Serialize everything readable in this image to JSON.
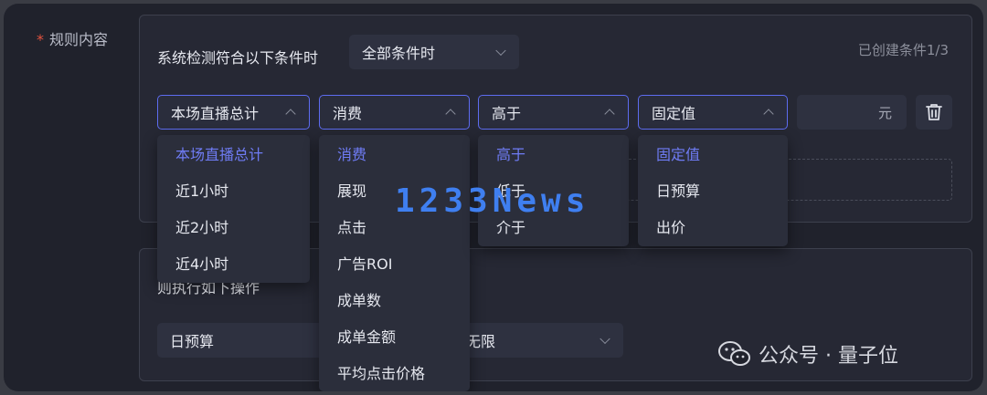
{
  "rule_label": "规则内容",
  "required_mark": "*",
  "trigger": {
    "label": "系统检测符合以下条件时",
    "select_value": "全部条件时",
    "created_count": "已创建条件1/3"
  },
  "condition": {
    "scope": "本场直播总计",
    "metric": "消费",
    "operator": "高于",
    "value_type": "固定值",
    "unit": "元"
  },
  "dropdowns": {
    "scope_options": [
      "本场直播总计",
      "近1小时",
      "近2小时",
      "近4小时"
    ],
    "metric_options": [
      "消费",
      "展现",
      "点击",
      "广告ROI",
      "成单数",
      "成单金额",
      "平均点击价格"
    ],
    "operator_options": [
      "高于",
      "低于",
      "介于"
    ],
    "value_type_options": [
      "固定值",
      "日预算",
      "出价"
    ]
  },
  "action": {
    "label": "则执行如下操作",
    "select_value": "日预算",
    "second_value": "无限"
  },
  "watermark": "1233News",
  "wechat": {
    "label": "公众号 · 量子位"
  }
}
